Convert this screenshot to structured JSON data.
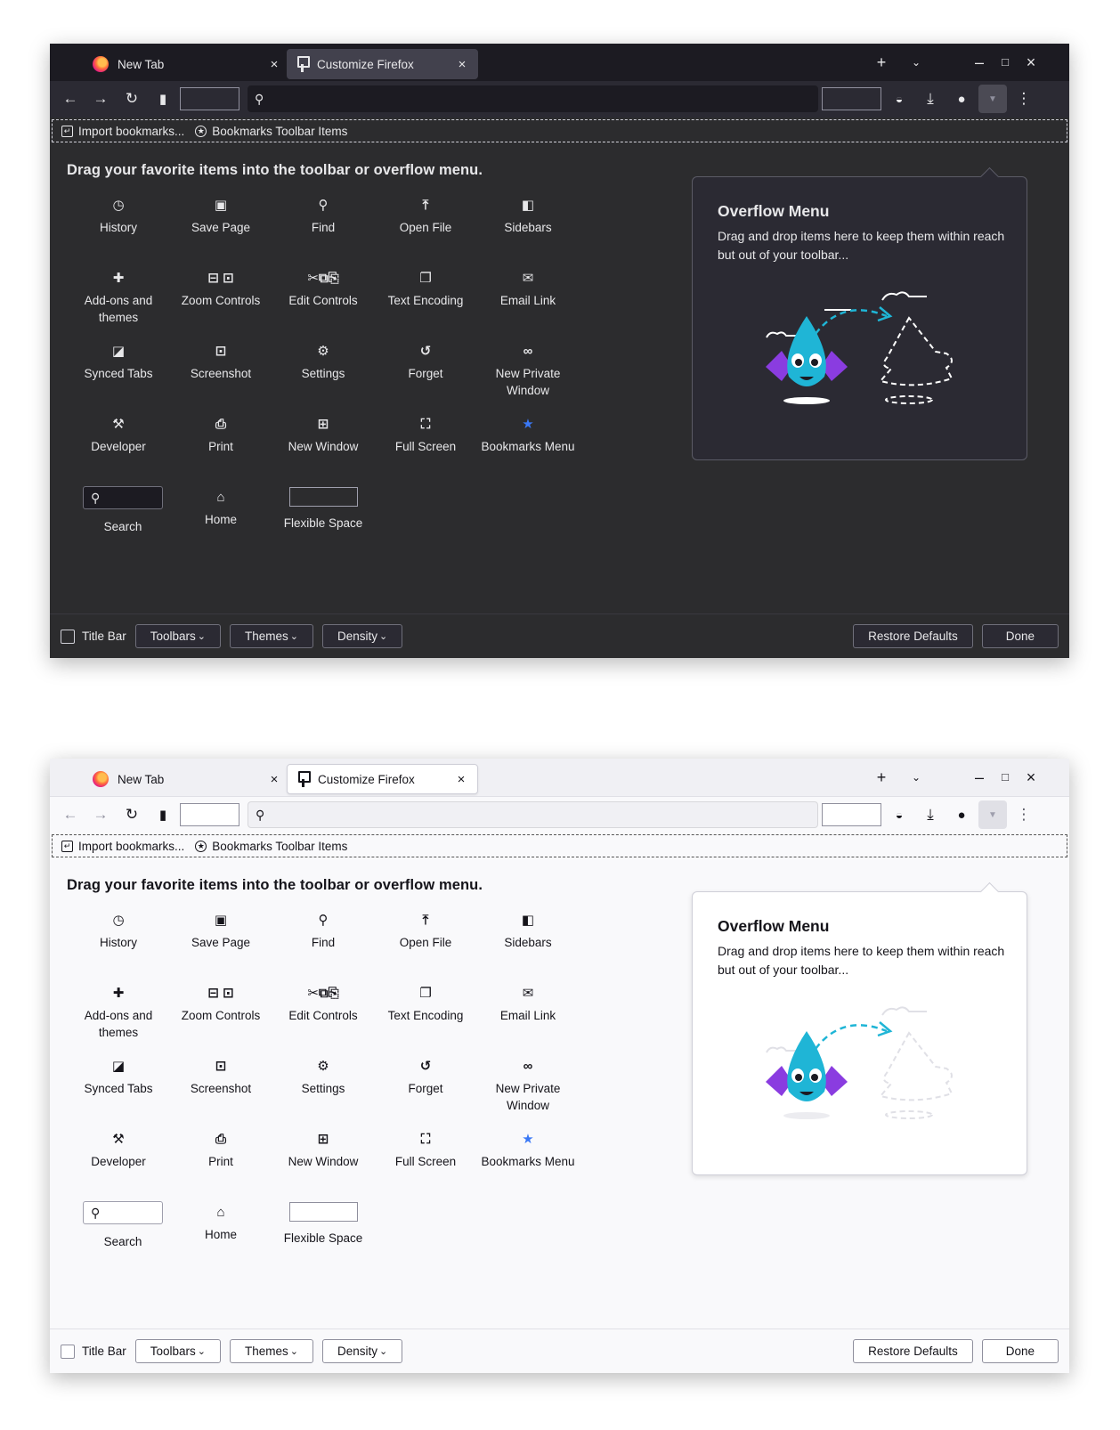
{
  "tabs": [
    {
      "label": "New Tab",
      "close": "×"
    },
    {
      "label": "Customize Firefox",
      "close": "×"
    }
  ],
  "strip": {
    "new_tab": "+",
    "list_all": "⌄",
    "minimize": "–",
    "maximize": "□",
    "close": "×"
  },
  "bookmarks": {
    "import_label": "Import bookmarks...",
    "toolbar_items_label": "Bookmarks Toolbar Items"
  },
  "instructions": "Drag your favorite items into the toolbar or overflow menu.",
  "palette": [
    {
      "label": "History",
      "icon": "history-icon"
    },
    {
      "label": "Save Page",
      "icon": "save-page-icon"
    },
    {
      "label": "Find",
      "icon": "find-icon"
    },
    {
      "label": "Open File",
      "icon": "open-file-icon"
    },
    {
      "label": "Sidebars",
      "icon": "sidebars-icon"
    },
    {
      "label": "Add-ons and themes",
      "icon": "addons-icon"
    },
    {
      "label": "Zoom Controls",
      "icon": "zoom-icon"
    },
    {
      "label": "Edit Controls",
      "icon": "edit-controls-icon"
    },
    {
      "label": "Text Encoding",
      "icon": "text-encoding-icon"
    },
    {
      "label": "Email Link",
      "icon": "email-icon"
    },
    {
      "label": "Synced Tabs",
      "icon": "synced-tabs-icon"
    },
    {
      "label": "Screenshot",
      "icon": "screenshot-icon"
    },
    {
      "label": "Settings",
      "icon": "settings-icon"
    },
    {
      "label": "Forget",
      "icon": "forget-icon"
    },
    {
      "label": "New Private Window",
      "icon": "private-window-icon"
    },
    {
      "label": "Developer",
      "icon": "developer-icon"
    },
    {
      "label": "Print",
      "icon": "print-icon"
    },
    {
      "label": "New Window",
      "icon": "new-window-icon"
    },
    {
      "label": "Full Screen",
      "icon": "full-screen-icon"
    },
    {
      "label": "Bookmarks Menu",
      "icon": "bookmarks-star-icon"
    },
    {
      "label": "Search",
      "icon": "search-icon"
    },
    {
      "label": "Home",
      "icon": "home-icon"
    },
    {
      "label": "Flexible Space",
      "icon": "flexible-space"
    }
  ],
  "overflow_panel": {
    "title": "Overflow Menu",
    "description": "Drag and drop items here to keep them within reach but out of your toolbar..."
  },
  "footer": {
    "title_bar": "Title Bar",
    "toolbars": "Toolbars",
    "themes": "Themes",
    "density": "Density",
    "restore": "Restore Defaults",
    "done": "Done"
  },
  "colors": {
    "dark_bg": "#2c2c2e",
    "light_bg": "#f9f9fb",
    "accent_blue": "#3a78f5",
    "dragon_cyan": "#1fb5d6",
    "dragon_purple": "#8a3ce0"
  }
}
